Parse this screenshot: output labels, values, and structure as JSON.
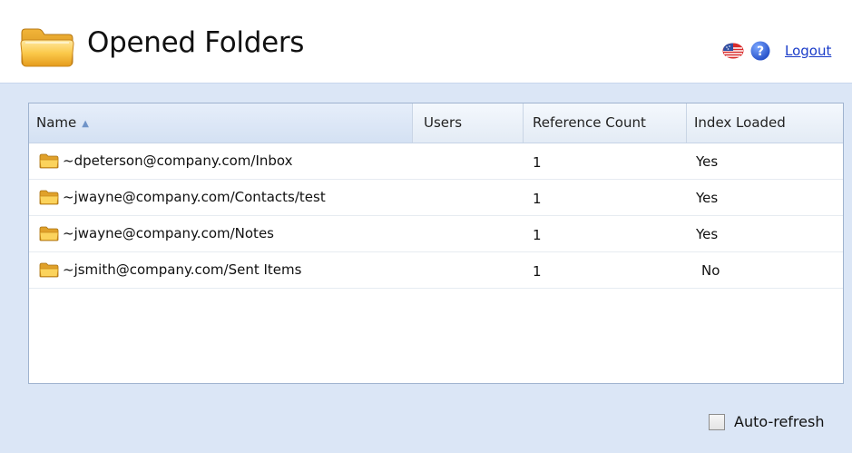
{
  "header": {
    "title": "Opened Folders",
    "folder_icon": "folder-icon",
    "flag_icon": "us-flag-icon",
    "help_icon": "help-icon",
    "logout_label": "Logout"
  },
  "table": {
    "columns": [
      {
        "label": "Name",
        "sorted": "ascending"
      },
      {
        "label": "Users"
      },
      {
        "label": "Reference Count"
      },
      {
        "label": "Index Loaded"
      }
    ],
    "rows": [
      {
        "name": "~dpeterson@company.com/Inbox",
        "users": "",
        "reference_count": "1",
        "index_loaded": "Yes"
      },
      {
        "name": "~jwayne@company.com/Contacts/test",
        "users": "",
        "reference_count": "1",
        "index_loaded": "Yes"
      },
      {
        "name": "~jwayne@company.com/Notes",
        "users": "",
        "reference_count": "1",
        "index_loaded": "Yes"
      },
      {
        "name": "~jsmith@company.com/Sent Items",
        "users": "",
        "reference_count": "1",
        "index_loaded": "No"
      }
    ]
  },
  "footer": {
    "auto_refresh_label": "Auto-refresh",
    "auto_refresh_checked": false
  },
  "colors": {
    "background": "#dbe6f6",
    "link": "#1a3cc9",
    "folder": "#f5b520",
    "header_selected": "#d4e1f3"
  }
}
